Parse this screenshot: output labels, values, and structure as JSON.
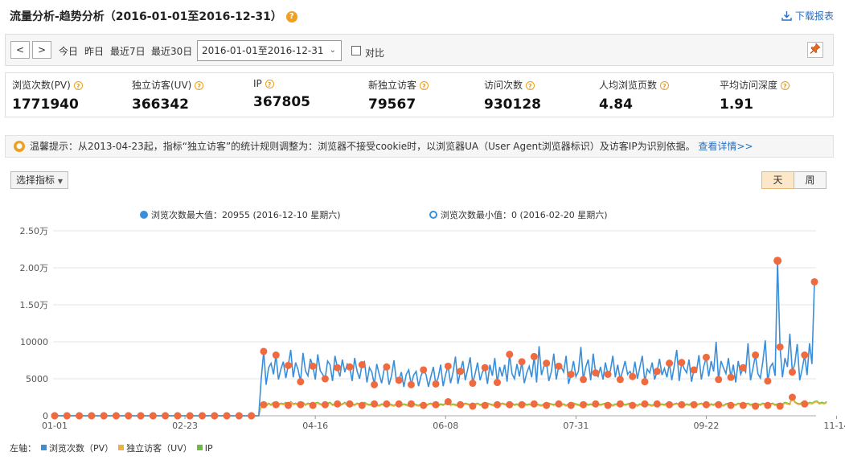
{
  "header": {
    "title": "流量分析-趋势分析（2016-01-01至2016-12-31）",
    "help_icon": "question-icon",
    "download_label": "下载报表",
    "download_icon": "download-icon"
  },
  "toolbar": {
    "prev": "<",
    "next": ">",
    "quick_ranges": [
      "今日",
      "昨日",
      "最近7日",
      "最近30日"
    ],
    "date_range": "2016-01-01至2016-12-31",
    "compare_label": "对比",
    "pin_icon": "pin-icon"
  },
  "metrics": [
    {
      "label": "浏览次数(PV)",
      "value": "1771940"
    },
    {
      "label": "独立访客(UV)",
      "value": "366342"
    },
    {
      "label": "IP",
      "value": "367805"
    },
    {
      "label": "新独立访客",
      "value": "79567"
    },
    {
      "label": "访问次数",
      "value": "930128"
    },
    {
      "label": "人均浏览页数",
      "value": "4.84"
    },
    {
      "label": "平均访问深度",
      "value": "1.91"
    }
  ],
  "notice": {
    "text": "温馨提示：从2013-04-23起，指标“独立访客”的统计规则调整为：浏览器不接受cookie时，以浏览器UA（User Agent浏览器标识）及访客IP为识别依据。",
    "link": "查看详情>>"
  },
  "controls": {
    "select_metric": "选择指标",
    "day": "天",
    "week": "周"
  },
  "chart_legend": {
    "max": "浏览次数最大值：20955 (2016-12-10 星期六)",
    "min": "浏览次数最小值：0 (2016-02-20 星期六)"
  },
  "bottom_legend": {
    "prefix": "左轴：",
    "items": [
      "浏览次数（PV）",
      "独立访客（UV）",
      "IP"
    ]
  },
  "colors": {
    "pv": "#3a8fd8",
    "uv": "#f0b040",
    "ip": "#6abe3a",
    "marker": "#f06a40",
    "accent": "#f0a020",
    "link": "#2a6fbf"
  },
  "chart_data": {
    "type": "line",
    "x_ticks": [
      "01-01",
      "02-23",
      "04-16",
      "06-08",
      "07-31",
      "09-22",
      "11-14"
    ],
    "y_ticks": [
      "0",
      "5000",
      "10000",
      "1.50万",
      "2.00万",
      "2.50万"
    ],
    "ylim": [
      0,
      25000
    ],
    "grid": true,
    "series": [
      {
        "name": "浏览次数（PV）",
        "values": [
          0,
          0,
          0,
          0,
          0,
          0,
          0,
          0,
          0,
          0,
          0,
          0,
          0,
          0,
          0,
          0,
          0,
          0,
          0,
          0,
          0,
          0,
          0,
          0,
          0,
          0,
          0,
          0,
          0,
          0,
          0,
          0,
          0,
          0,
          0,
          0,
          0,
          0,
          0,
          0,
          0,
          0,
          0,
          0,
          0,
          0,
          0,
          0,
          0,
          0,
          0,
          0,
          0,
          0,
          0,
          0,
          0,
          0,
          0,
          0,
          0,
          0,
          0,
          0,
          0,
          0,
          0,
          0,
          0,
          0,
          0,
          0,
          0,
          0,
          0,
          0,
          0,
          0,
          0,
          0,
          0,
          0,
          0,
          0,
          5000,
          8700,
          4200,
          6500,
          7100,
          5600,
          8200,
          4900,
          6300,
          7300,
          5100,
          6800,
          8900,
          5200,
          7200,
          6200,
          4600,
          8500,
          6100,
          5400,
          7700,
          6700,
          4900,
          8300,
          6100,
          5600,
          5000,
          7400,
          6900,
          4700,
          8100,
          6500,
          5300,
          7600,
          5900,
          7000,
          6600,
          4700,
          7800,
          6000,
          5000,
          6900,
          7300,
          4500,
          6500,
          5900,
          4200,
          7000,
          5600,
          4400,
          6300,
          6600,
          4200,
          5400,
          7500,
          4600,
          4800,
          5900,
          3900,
          5600,
          6200,
          4200,
          5500,
          6000,
          4000,
          5400,
          6200,
          5600,
          3900,
          5300,
          6600,
          4300,
          5200,
          6900,
          4000,
          5600,
          6700,
          4400,
          5800,
          8000,
          4300,
          6000,
          7400,
          4800,
          6300,
          7900,
          4400,
          5700,
          7200,
          4800,
          5900,
          6500,
          4300,
          6900,
          5400,
          7800,
          4500,
          6600,
          5300,
          6900,
          4600,
          8300,
          5700,
          5000,
          7000,
          5300,
          7300,
          4400,
          5800,
          6700,
          5200,
          8000,
          4500,
          9400,
          5500,
          6700,
          7100,
          4700,
          6000,
          8400,
          4900,
          6700,
          6600,
          5900,
          8100,
          4300,
          5600,
          7400,
          5300,
          6000,
          9300,
          4900,
          6600,
          7600,
          4800,
          8400,
          5800,
          5300,
          6600,
          4900,
          7200,
          5600,
          6100,
          8100,
          5200,
          6900,
          4900,
          6100,
          7400,
          5600,
          6000,
          5300,
          7300,
          5000,
          6600,
          8100,
          4600,
          6300,
          5800,
          7200,
          4900,
          6000,
          7700,
          5500,
          6400,
          5200,
          7100,
          4800,
          6800,
          8900,
          4700,
          7200,
          6400,
          5800,
          7600,
          4600,
          6200,
          5900,
          8200,
          4900,
          6700,
          7900,
          5300,
          7400,
          6000,
          10000,
          4900,
          7400,
          6500,
          5700,
          7800,
          5200,
          6900,
          4500,
          7400,
          5600,
          6500,
          5900,
          9800,
          4800,
          6400,
          8200,
          5700,
          5100,
          7300,
          10200,
          4700,
          6600,
          7100,
          5400,
          20955,
          9300,
          5200,
          7800,
          6600,
          11100,
          5900,
          7000,
          9700,
          4800,
          6300,
          8200,
          5500,
          9800,
          7000,
          18100
        ]
      },
      {
        "name": "独立访客（UV）",
        "values": [
          0,
          0,
          0,
          0,
          0,
          0,
          0,
          0,
          0,
          0,
          0,
          0,
          0,
          0,
          0,
          0,
          0,
          0,
          0,
          0,
          0,
          0,
          0,
          0,
          0,
          0,
          0,
          0,
          0,
          0,
          0,
          0,
          0,
          0,
          0,
          0,
          0,
          0,
          0,
          0,
          0,
          0,
          0,
          0,
          0,
          0,
          0,
          0,
          0,
          0,
          0,
          0,
          0,
          0,
          0,
          0,
          0,
          0,
          0,
          0,
          0,
          0,
          0,
          0,
          0,
          0,
          0,
          0,
          0,
          0,
          0,
          0,
          0,
          0,
          0,
          0,
          0,
          0,
          0,
          0,
          0,
          0,
          0,
          0,
          1200,
          1500,
          1300,
          1600,
          1400,
          1700,
          1500,
          1400,
          1600,
          1500,
          1700,
          1400,
          1800,
          1500,
          1600,
          1400,
          1500,
          1700,
          1400,
          1600,
          1500,
          1400,
          1600,
          1700,
          1500,
          1400,
          1500,
          1600,
          1700,
          1400,
          1500,
          1600,
          1400,
          1500,
          1700,
          1400,
          1600,
          1500,
          1400,
          1600,
          1500,
          1400,
          1700,
          1500,
          1400,
          1500,
          1600,
          1400,
          1300,
          1500,
          1400,
          1600,
          1500,
          1400,
          1300,
          1500,
          1600,
          1400,
          1500,
          1400,
          1300,
          1600,
          1500,
          1400,
          1300,
          1500,
          1400,
          1300,
          1500,
          1600,
          1400,
          1500,
          1300,
          1500,
          1400,
          1600,
          1900,
          1400,
          1500,
          1400,
          1300,
          1500,
          1400,
          1600,
          1500,
          1400,
          1300,
          1500,
          1600,
          1400,
          1500,
          1400,
          1600,
          1500,
          1400,
          1300,
          1500,
          1400,
          1600,
          1500,
          1400,
          1500,
          1600,
          1400,
          1500,
          1300,
          1500,
          1600,
          1400,
          1500,
          1400,
          1600,
          1500,
          1400,
          1300,
          1500,
          1400,
          1600,
          1500,
          1400,
          1500,
          1600,
          1400,
          1500,
          1300,
          1500,
          1400,
          1600,
          1500,
          1400,
          1300,
          1500,
          1600,
          1400,
          1500,
          1400,
          1600,
          1500,
          1400,
          1500,
          1600,
          1400,
          1500,
          1300,
          1500,
          1400,
          1600,
          1500,
          1400,
          1500,
          1600,
          1400,
          1500,
          1300,
          1500,
          1400,
          1600,
          1500,
          1400,
          1300,
          1500,
          1600,
          1400,
          1500,
          1400,
          1600,
          1500,
          1400,
          1500,
          1600,
          1400,
          1500,
          1300,
          1500,
          1400,
          1600,
          1500,
          1400,
          1500,
          1600,
          1400,
          1500,
          1300,
          1500,
          1400,
          1600,
          1500,
          1400,
          1300,
          1500,
          1600,
          1400,
          1500,
          1400,
          1600,
          1500,
          1400,
          1500,
          1600,
          1400,
          1500,
          1300,
          1500,
          1400,
          1600,
          1500,
          1400,
          1500,
          1600,
          1400,
          1500,
          1300,
          1500,
          1700,
          1600,
          1500,
          2500,
          1800,
          1600,
          1500,
          1700,
          1600,
          1500,
          1700,
          1600,
          1800,
          1900,
          1600,
          1700,
          1600,
          1800
        ]
      },
      {
        "name": "IP",
        "values": [
          0,
          0,
          0,
          0,
          0,
          0,
          0,
          0,
          0,
          0,
          0,
          0,
          0,
          0,
          0,
          0,
          0,
          0,
          0,
          0,
          0,
          0,
          0,
          0,
          0,
          0,
          0,
          0,
          0,
          0,
          0,
          0,
          0,
          0,
          0,
          0,
          0,
          0,
          0,
          0,
          0,
          0,
          0,
          0,
          0,
          0,
          0,
          0,
          0,
          0,
          0,
          0,
          0,
          0,
          0,
          0,
          0,
          0,
          0,
          0,
          0,
          0,
          0,
          0,
          0,
          0,
          0,
          0,
          0,
          0,
          0,
          0,
          0,
          0,
          0,
          0,
          0,
          0,
          0,
          0,
          0,
          0,
          0,
          0,
          1300,
          1600,
          1400,
          1700,
          1500,
          1800,
          1600,
          1500,
          1700,
          1600,
          1800,
          1500,
          1900,
          1600,
          1700,
          1500,
          1600,
          1800,
          1500,
          1700,
          1600,
          1500,
          1700,
          1800,
          1600,
          1500,
          1600,
          1700,
          1800,
          1500,
          1600,
          1700,
          1500,
          1600,
          1800,
          1500,
          1700,
          1600,
          1500,
          1700,
          1600,
          1500,
          1800,
          1600,
          1500,
          1600,
          1700,
          1500,
          1400,
          1600,
          1500,
          1700,
          1600,
          1500,
          1400,
          1600,
          1700,
          1500,
          1600,
          1500,
          1400,
          1700,
          1600,
          1500,
          1400,
          1600,
          1500,
          1400,
          1600,
          1700,
          1500,
          1600,
          1400,
          1600,
          1500,
          1700,
          2000,
          1500,
          1600,
          1500,
          1400,
          1600,
          1500,
          1700,
          1600,
          1500,
          1400,
          1600,
          1700,
          1500,
          1600,
          1500,
          1700,
          1600,
          1500,
          1400,
          1600,
          1500,
          1700,
          1600,
          1500,
          1600,
          1700,
          1500,
          1600,
          1400,
          1600,
          1700,
          1500,
          1600,
          1500,
          1700,
          1600,
          1500,
          1400,
          1600,
          1500,
          1700,
          1600,
          1500,
          1600,
          1700,
          1500,
          1600,
          1400,
          1600,
          1500,
          1700,
          1600,
          1500,
          1400,
          1600,
          1700,
          1500,
          1600,
          1500,
          1700,
          1600,
          1500,
          1600,
          1700,
          1500,
          1600,
          1400,
          1600,
          1500,
          1700,
          1600,
          1500,
          1600,
          1700,
          1500,
          1600,
          1400,
          1600,
          1500,
          1700,
          1600,
          1500,
          1400,
          1600,
          1700,
          1500,
          1600,
          1500,
          1700,
          1600,
          1500,
          1600,
          1700,
          1500,
          1600,
          1400,
          1600,
          1500,
          1700,
          1600,
          1500,
          1600,
          1700,
          1500,
          1600,
          1400,
          1600,
          1500,
          1700,
          1600,
          1500,
          1400,
          1600,
          1700,
          1500,
          1600,
          1500,
          1700,
          1600,
          1500,
          1600,
          1700,
          1500,
          1600,
          1400,
          1600,
          1500,
          1700,
          1600,
          1500,
          1600,
          1700,
          1500,
          1600,
          1400,
          1600,
          1800,
          1700,
          1600,
          2600,
          1900,
          1700,
          1600,
          1800,
          1700,
          1600,
          1800,
          1700,
          1900,
          2000,
          1700,
          1800,
          1700,
          1900
        ]
      }
    ]
  }
}
